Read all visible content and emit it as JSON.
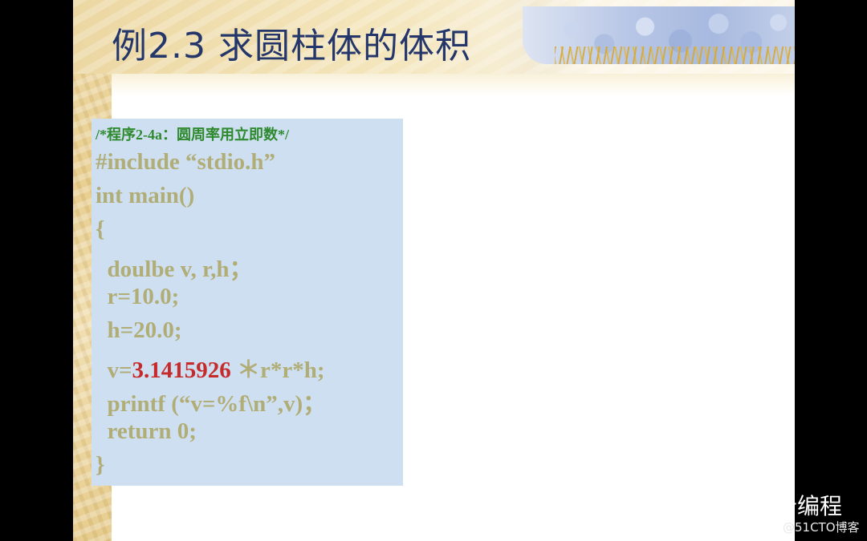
{
  "slide": {
    "title": "例2.3 求圆柱体的体积"
  },
  "code": {
    "comment": "/*程序2-4a：圆周率用立即数*/",
    "line1": "#include “stdio.h”",
    "line2": "int  main()",
    "line3": "{",
    "line4": "  doulbe v, r,h；",
    "line5": "  r=10.0;",
    "line6": "  h=20.0;",
    "line7_prefix": "  v=",
    "line7_number": "3.1415926",
    "line7_suffix": " ＊r*r*h;",
    "line8": "  printf (“v=%f\\n”,v)；",
    "line9": "  return 0;",
    "line10": "}"
  },
  "watermark": {
    "icon": "wechat-icon",
    "name": "冰岩编程",
    "source": "@51CTO博客"
  },
  "colors": {
    "title": "#24366a",
    "comment": "#2f8a2f",
    "code": "#b1ad77",
    "number": "#c62b2b",
    "code_bg": "#cedff1"
  }
}
